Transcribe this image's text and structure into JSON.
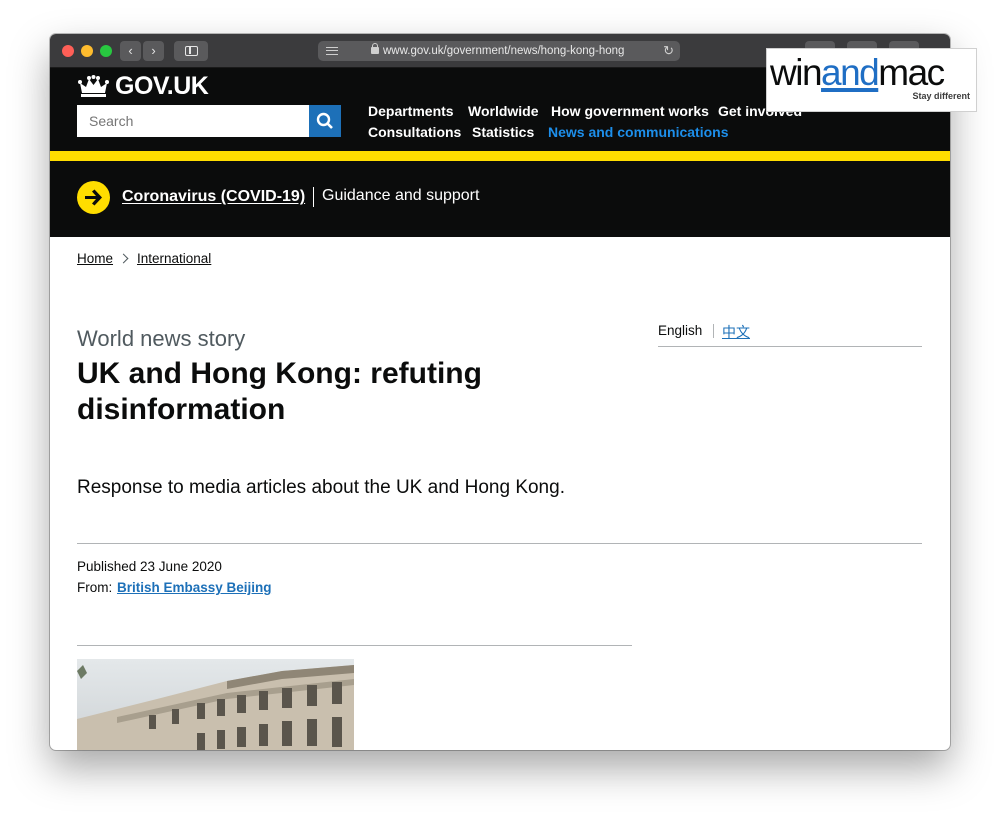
{
  "browser": {
    "url": "www.gov.uk/government/news/hong-kong-hong"
  },
  "header": {
    "logo": "GOV.UK",
    "search_placeholder": "Search",
    "nav": [
      {
        "label": "Departments",
        "active": false
      },
      {
        "label": "Worldwide",
        "active": false
      },
      {
        "label": "How government works",
        "active": false
      },
      {
        "label": "Get involved",
        "active": false
      },
      {
        "label": "Consultations",
        "active": false
      },
      {
        "label": "Statistics",
        "active": false
      },
      {
        "label": "News and communications",
        "active": true
      }
    ]
  },
  "covid_banner": {
    "link": "Coronavirus (COVID-19)",
    "text": "Guidance and support"
  },
  "breadcrumb": [
    "Home",
    "International"
  ],
  "article": {
    "caption": "World news story",
    "title": "UK and Hong Kong: refuting disinformation",
    "lead": "Response to media articles about the UK and Hong Kong.",
    "published": "Published 23 June 2020",
    "from_label": "From:",
    "from_link": "British Embassy Beijing"
  },
  "languages": {
    "current": "English",
    "alternate": "中文"
  },
  "watermark": {
    "brand_prefix": "win",
    "brand_mid": "and",
    "brand_suffix": "mac",
    "tagline": "Stay different"
  },
  "colors": {
    "gov_black": "#0b0c0c",
    "gov_yellow": "#ffdd00",
    "link_blue": "#1d70b8",
    "active_nav": "#1d8feb"
  }
}
